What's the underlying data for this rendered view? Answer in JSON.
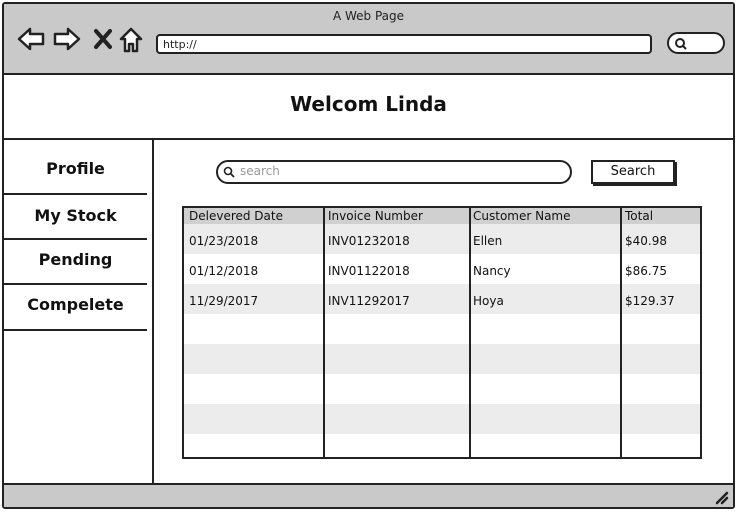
{
  "window": {
    "title": "A Web Page"
  },
  "browser": {
    "url": "http://"
  },
  "header": {
    "title": "Welcom Linda"
  },
  "sidebar": {
    "items": [
      {
        "label": "Profile"
      },
      {
        "label": "My Stock"
      },
      {
        "label": "Pending"
      },
      {
        "label": "Compelete"
      }
    ]
  },
  "search": {
    "placeholder": "search",
    "button_label": "Search"
  },
  "table": {
    "columns": [
      "Delevered Date",
      "Invoice Number",
      "Customer Name",
      "Total"
    ],
    "rows": [
      [
        "01/23/2018",
        "INV01232018",
        "Ellen",
        "$40.98"
      ],
      [
        "01/12/2018",
        "INV01122018",
        "Nancy",
        "$86.75"
      ],
      [
        "11/29/2017",
        "INV11292017",
        "Hoya",
        "$129.37"
      ]
    ]
  },
  "icons": {
    "back": "back-arrow-icon",
    "forward": "forward-arrow-icon",
    "close": "close-icon",
    "home": "home-icon",
    "search": "search-icon",
    "resize": "resize-grip-icon"
  }
}
